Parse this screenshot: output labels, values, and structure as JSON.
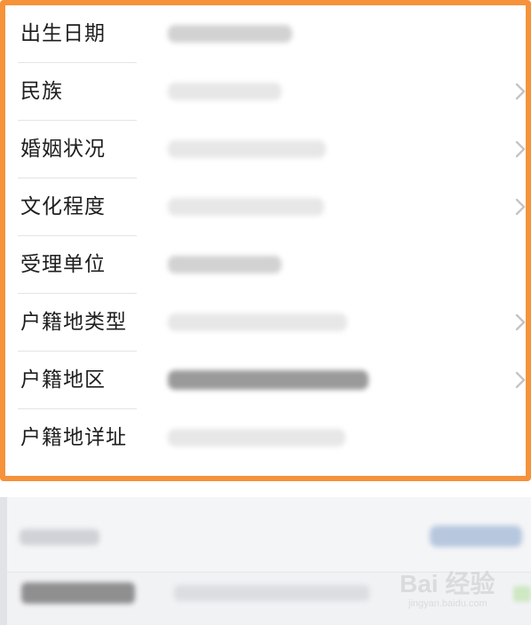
{
  "form": {
    "rows": [
      {
        "label": "出生日期",
        "has_chevron": false
      },
      {
        "label": "民族",
        "has_chevron": true
      },
      {
        "label": "婚姻状况",
        "has_chevron": true
      },
      {
        "label": "文化程度",
        "has_chevron": true
      },
      {
        "label": "受理单位",
        "has_chevron": false
      },
      {
        "label": "户籍地类型",
        "has_chevron": true
      },
      {
        "label": "户籍地区",
        "has_chevron": true
      },
      {
        "label": "户籍地详址",
        "has_chevron": false
      }
    ]
  },
  "icons": {
    "chevron": "chevron-right-icon",
    "watermark": "baidu-paw-logo"
  },
  "colors": {
    "highlight_border": "#f5923a",
    "label_text": "#1e1e1e",
    "section_bg": "#f4f5f7"
  },
  "watermark": {
    "logo_text": "Bai 经验",
    "site_text": "jingyan.baidu.com"
  }
}
